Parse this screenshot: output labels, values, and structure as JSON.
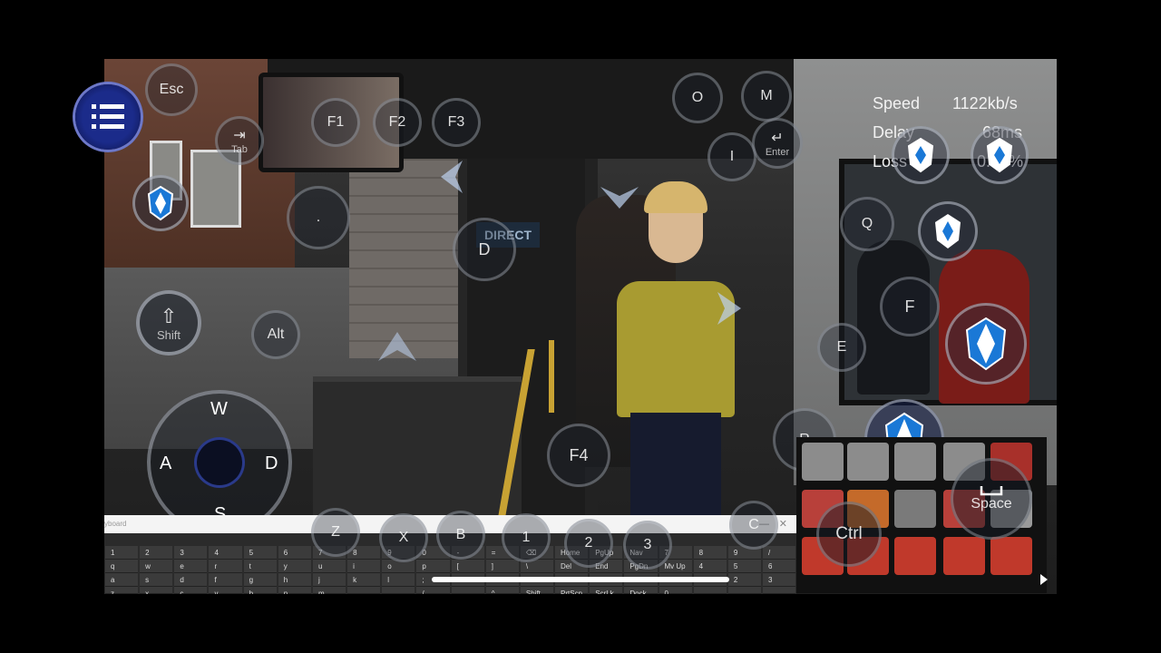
{
  "net": {
    "speed_label": "Speed",
    "speed_value": "1122kb/s",
    "delay_label": "Delay",
    "delay_value": "68ms",
    "loss_label": "Loss",
    "loss_value": "0.00%"
  },
  "keys": {
    "esc": "Esc",
    "tab_icon": "⇥",
    "tab": "Tab",
    "f1": "F1",
    "f2": "F2",
    "f3": "F3",
    "o": "O",
    "m": "M",
    "enter_icon": "↵",
    "enter": "Enter",
    "i": "I",
    "period": ".",
    "d_top": "D",
    "q": "Q",
    "f": "F",
    "e": "E",
    "shift_icon": "⇧",
    "shift": "Shift",
    "alt": "Alt",
    "f4": "F4",
    "r": "R",
    "ctrl": "Ctrl",
    "space": "Space",
    "z": "Z",
    "x": "X",
    "b": "B",
    "n1": "1",
    "n2": "2",
    "n3": "3",
    "c": "C"
  },
  "joystick": {
    "up": "W",
    "left": "A",
    "right": "D",
    "down": "S"
  },
  "scene": {
    "destination": "DIRECT"
  },
  "osk": {
    "title": "yboard",
    "rows": [
      [
        "1",
        "2",
        "3",
        "4",
        "5",
        "6",
        "7",
        "8",
        "9",
        "0",
        "-",
        "=",
        "⌫",
        "Home",
        "PgUp",
        "Nav",
        "7",
        "8",
        "9",
        "/"
      ],
      [
        "q",
        "w",
        "e",
        "r",
        "t",
        "y",
        "u",
        "i",
        "o",
        "p",
        "[",
        "]",
        "\\",
        "Del",
        "End",
        "PgDn",
        "Mv Up",
        "4",
        "5",
        "6"
      ],
      [
        "a",
        "s",
        "d",
        "f",
        "g",
        "h",
        "j",
        "k",
        "l",
        ";",
        "'",
        "",
        "",
        "",
        "",
        "",
        "",
        "1",
        "2",
        "3"
      ],
      [
        "z",
        "x",
        "c",
        "v",
        "b",
        "n",
        "m",
        ",",
        ".",
        "/",
        "",
        "^",
        "Shift",
        "PrtScn",
        "ScrLk",
        "Dock",
        "0",
        "",
        ".",
        ""
      ]
    ]
  },
  "colors": {
    "accent": "#1b2b8a",
    "shield": "#1a78d6",
    "ring": "#c8cdd7"
  }
}
